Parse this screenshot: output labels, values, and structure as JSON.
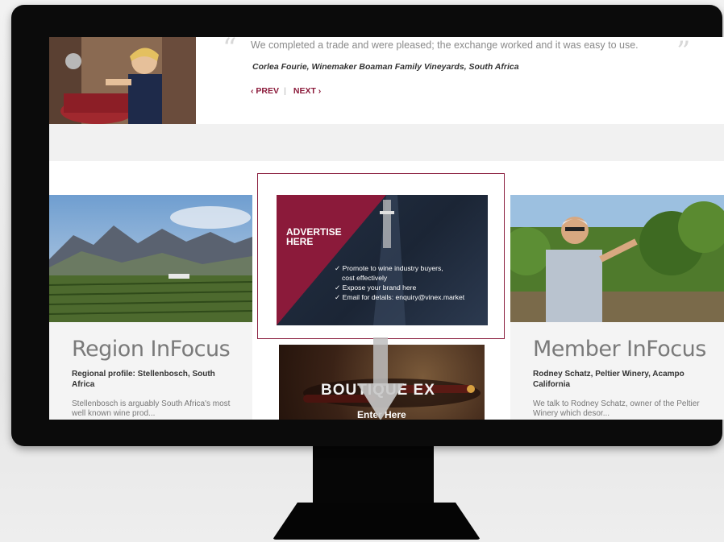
{
  "testimonial": {
    "quote": "We completed a trade and were pleased; the exchange worked and it was easy to use.",
    "author": "Corlea Fourie, Winemaker Boaman Family Vineyards, South Africa",
    "prev_label": "‹ PREV",
    "next_label": "NEXT ›",
    "open_quote": "“",
    "close_quote": "”"
  },
  "region": {
    "title": "Region InFocus",
    "subtitle": "Regional profile: Stellenbosch, South Africa",
    "body": "Stellenbosch is arguably South Africa's most well known wine prod..."
  },
  "advert": {
    "title_line1": "ADVERTISE",
    "title_line2": "HERE",
    "bullets": [
      "✓ Promote to wine industry buyers,",
      "cost effectively",
      "✓ Expose your brand here",
      "✓ Email for details: enquiry@vinex.market"
    ]
  },
  "boutique": {
    "title": "BOUTIQUE EX",
    "cta": "Enter Here"
  },
  "member": {
    "title": "Member InFocus",
    "subtitle": "Rodney Schatz, Peltier Winery, Acampo California",
    "body": "We talk to Rodney Schatz, owner of the Peltier Winery which desor..."
  },
  "colors": {
    "accent": "#8b1a3a",
    "monitor_frame": "#0b0b0b"
  }
}
